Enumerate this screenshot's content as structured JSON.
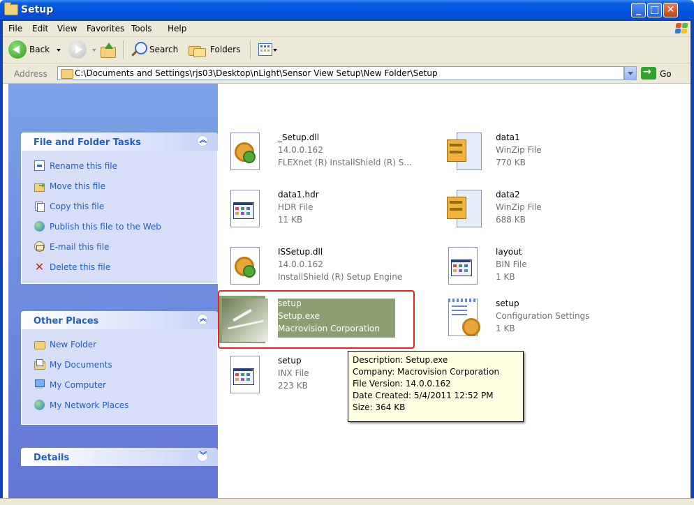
{
  "window": {
    "title": "Setup"
  },
  "menu": [
    "File",
    "Edit",
    "View",
    "Favorites",
    "Tools",
    "Help"
  ],
  "toolbar": {
    "back_label": "Back",
    "search_label": "Search",
    "folders_label": "Folders"
  },
  "address": {
    "label": "Address",
    "path": "C:\\Documents and Settings\\rjs03\\Desktop\\nLight\\Sensor View Setup\\New Folder\\Setup",
    "go_label": "Go"
  },
  "file_tasks": {
    "title": "File and Folder Tasks",
    "items": [
      {
        "label": "Rename this file",
        "icon": "rename-icon"
      },
      {
        "label": "Move this file",
        "icon": "move-icon"
      },
      {
        "label": "Copy this file",
        "icon": "copy-icon"
      },
      {
        "label": "Publish this file to the Web",
        "icon": "globe-icon"
      },
      {
        "label": "E-mail this file",
        "icon": "email-icon"
      },
      {
        "label": "Delete this file",
        "icon": "delete-icon"
      }
    ]
  },
  "other_places": {
    "title": "Other Places",
    "items": [
      {
        "label": "New Folder",
        "icon": "folder-icon"
      },
      {
        "label": "My Documents",
        "icon": "my-documents-icon"
      },
      {
        "label": "My Computer",
        "icon": "my-computer-icon"
      },
      {
        "label": "My Network Places",
        "icon": "network-places-icon"
      }
    ]
  },
  "details": {
    "title": "Details"
  },
  "files": [
    {
      "name": "_Setup.dll",
      "line2": "14.0.0.162",
      "line3": "FLEXnet (R) InstallShield (R) S...",
      "icon": "dll-gear-icon"
    },
    {
      "name": "data1",
      "line2": "WinZip File",
      "line3": "770 KB",
      "icon": "winzip-icon"
    },
    {
      "name": "data1.hdr",
      "line2": "HDR File",
      "line3": "11 KB",
      "icon": "generic-file-icon"
    },
    {
      "name": "data2",
      "line2": "WinZip File",
      "line3": "688 KB",
      "icon": "winzip-icon"
    },
    {
      "name": "ISSetup.dll",
      "line2": "14.0.0.162",
      "line3": "InstallShield (R) Setup Engine",
      "icon": "dll-gear-icon"
    },
    {
      "name": "layout",
      "line2": "BIN File",
      "line3": "1 KB",
      "icon": "generic-file-icon"
    },
    {
      "name": "setup",
      "line2": "Setup.exe",
      "line3": "Macrovision Corporation",
      "icon": "setup-exe-icon",
      "selected": true
    },
    {
      "name": "setup",
      "line2": "Configuration Settings",
      "line3": "1 KB",
      "icon": "config-settings-icon"
    },
    {
      "name": "setup",
      "line2": "INX File",
      "line3": "223 KB",
      "icon": "generic-file-icon"
    }
  ],
  "tooltip": {
    "description": "Description: Setup.exe",
    "company": "Company: Macrovision Corporation",
    "file_version": "File Version: 14.0.0.162",
    "date_created": "Date Created: 5/4/2011 12:52 PM",
    "size": "Size: 364 KB"
  },
  "colors": {
    "title_bar": "#0054e3",
    "task_pane": "#6f8de0",
    "panel_body": "#d6dff7",
    "selection": "#8c9e72",
    "annotation_red": "#ec2020",
    "tooltip_bg": "#ffffe1"
  }
}
